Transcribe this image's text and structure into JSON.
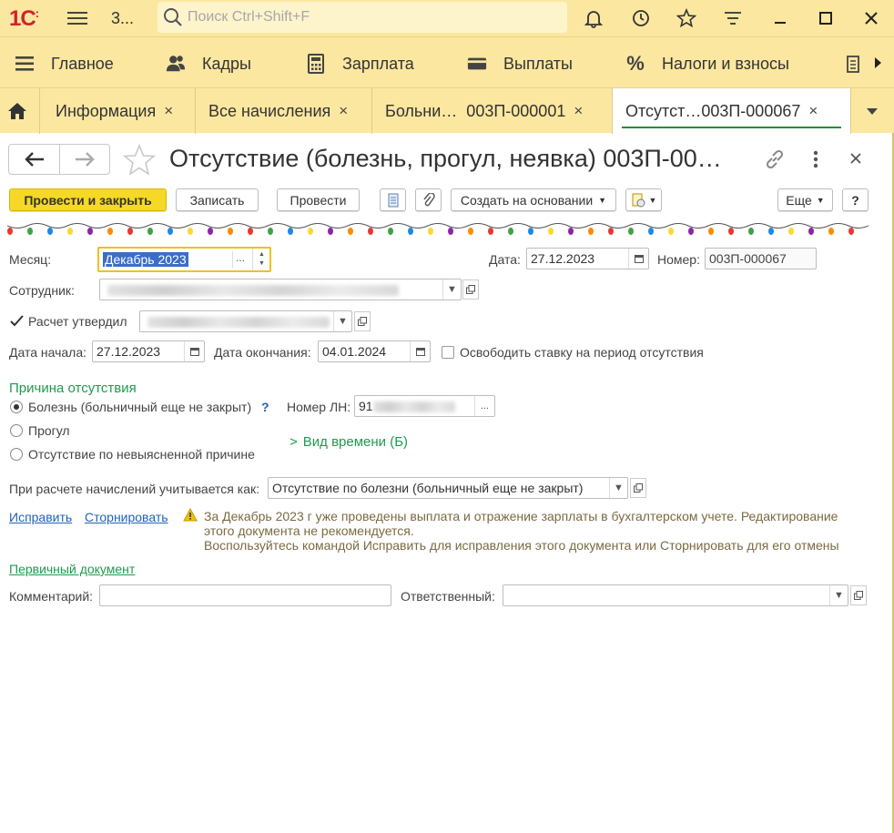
{
  "titlebar": {
    "logo": "1С",
    "app_title": "3...",
    "search_placeholder": "Поиск Ctrl+Shift+F"
  },
  "sections": [
    {
      "label": "Главное",
      "icon": "menu-icon"
    },
    {
      "label": "Кадры",
      "icon": "people-icon"
    },
    {
      "label": "Зарплата",
      "icon": "calculator-icon"
    },
    {
      "label": "Выплаты",
      "icon": "wallet-icon"
    },
    {
      "label": "Налоги и взносы",
      "icon": "percent-icon"
    }
  ],
  "tabs": [
    {
      "label": "Информация",
      "close": "×"
    },
    {
      "label": "Все начисления",
      "close": "×"
    },
    {
      "label": "Больни…  003П-000001",
      "close": "×"
    },
    {
      "label": "Отсутст…003П-000067",
      "close": "×",
      "active": true
    }
  ],
  "document": {
    "title": "Отсутствие (болезнь, прогул, неявка) 003П-00…"
  },
  "toolbar": {
    "post_close": "Провести и закрыть",
    "save": "Записать",
    "post": "Провести",
    "create_based": "Создать на основании",
    "more": "Еще",
    "help": "?"
  },
  "form": {
    "month_label": "Месяц:",
    "month_value": "Декабрь 2023",
    "date_label": "Дата:",
    "date_value": "27.12.2023",
    "number_label": "Номер:",
    "number_value": "003П-000067",
    "employee_label": "Сотрудник:",
    "approved_label": "Расчет утвердил",
    "start_label": "Дата начала:",
    "start_value": "27.12.2023",
    "end_label": "Дата окончания:",
    "end_value": "04.01.2024",
    "free_rate_label": "Освободить ставку на период отсутствия",
    "reason_header": "Причина отсутствия",
    "reason_illness": "Болезнь (больничный еще не закрыт)",
    "reason_help": "?",
    "reason_truancy": "Прогул",
    "reason_unknown": "Отсутствие по невыясненной причине",
    "ln_label": "Номер ЛН:",
    "ln_value": "91",
    "time_kind": "Вид времени (Б)",
    "accrual_label": "При расчете начислений учитывается как:",
    "accrual_value": "Отсутствие по болезни (больничный еще не закрыт)",
    "fix_link": "Исправить",
    "storno_link": "Сторнировать",
    "warning_line1": "За Декабрь 2023 г уже проведены выплата и отражение зарплаты в бухгалтерском учете. Редактирование",
    "warning_line2": "этого документа не рекомендуется.",
    "warning_line3": "Воспользуйтесь командой Исправить для исправления этого документа или Сторнировать для его отмены",
    "primary_doc_link": "Первичный документ",
    "comment_label": "Комментарий:",
    "comment_value": "",
    "responsible_label": "Ответственный:",
    "responsible_value": ""
  },
  "colors": {
    "accent_yellow": "#fbe7a0",
    "primary_button": "#f6d827",
    "green": "#1e9b4c",
    "link_blue": "#2163b8"
  }
}
